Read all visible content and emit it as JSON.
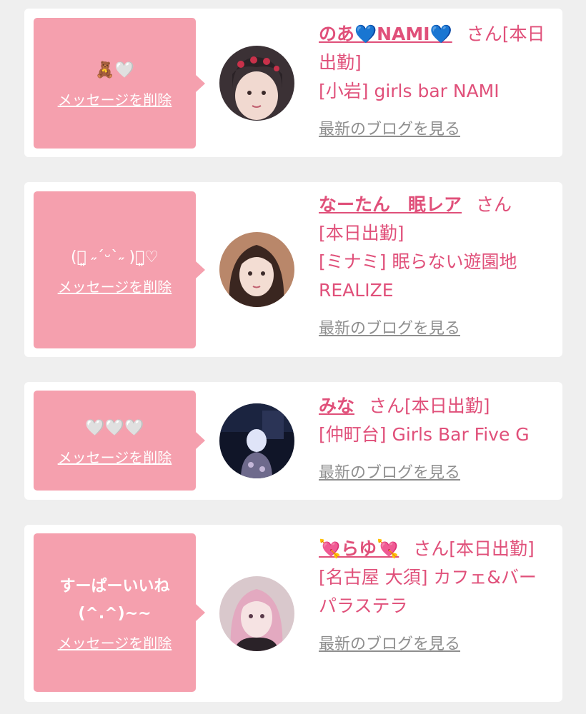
{
  "common": {
    "delete_label": "メッセージを削除",
    "blog_label": "最新のブログを見る",
    "san_suffix": "さん"
  },
  "entries": [
    {
      "message": "🧸🤍",
      "name": "のあ💙NAMI💙",
      "status": "[本日出勤]",
      "shop": "[小岩] girls bar NAMI"
    },
    {
      "message": "(ྀ͈ ˶ˊᵕˋ˶ )ྀ͈♡",
      "name": "なーたん　眠レア",
      "status": "[本日出勤]",
      "shop": "[ミナミ] 眠らない遊園地REALIZE"
    },
    {
      "message": "🤍🤍🤍",
      "name": "みな",
      "status": "[本日出勤]",
      "shop": "[仲町台] Girls Bar Five G"
    },
    {
      "message": "すーぱーいいね\n(^.^)~~",
      "name": "💘らゆ💘",
      "status": "[本日出勤]",
      "shop": "[名古屋 大須] カフェ&バー パラステラ"
    }
  ]
}
